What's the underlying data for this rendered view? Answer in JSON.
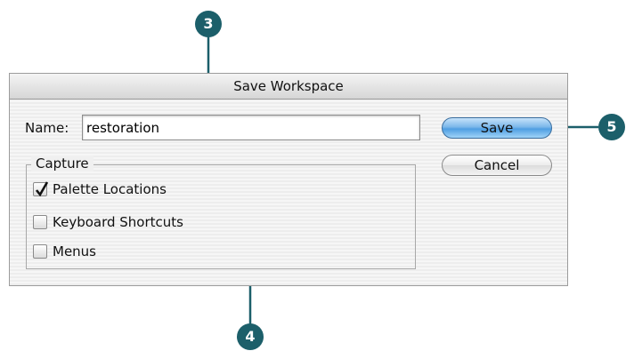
{
  "dialog": {
    "title": "Save Workspace",
    "name_label": "Name:",
    "name_value": "restoration",
    "capture": {
      "legend": "Capture",
      "options": [
        {
          "label": "Palette Locations",
          "checked": true
        },
        {
          "label": "Keyboard Shortcuts",
          "checked": false
        },
        {
          "label": "Menus",
          "checked": false
        }
      ]
    },
    "buttons": {
      "save": "Save",
      "cancel": "Cancel"
    }
  },
  "callouts": {
    "name": "3",
    "capture": "4",
    "save": "5"
  },
  "colors": {
    "callout": "#1c5f6a",
    "default_button": "#5aa5e5"
  }
}
